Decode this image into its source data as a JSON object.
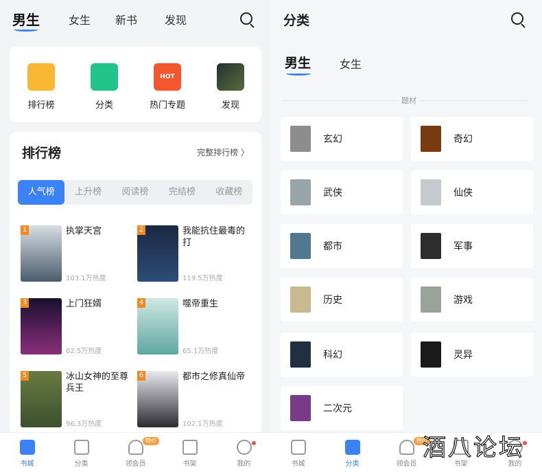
{
  "left": {
    "tabs": [
      "男生",
      "女生",
      "新书",
      "发现"
    ],
    "quick_entries": [
      {
        "label": "排行榜",
        "icon": "ranking-icon",
        "color": "#f7b733"
      },
      {
        "label": "分类",
        "icon": "category-icon",
        "color": "#22c48a"
      },
      {
        "label": "热门专题",
        "icon": "hot-topic-icon",
        "color": "#f4572e"
      },
      {
        "label": "发现",
        "icon": "discover-icon",
        "color": "#3a4a5a"
      }
    ],
    "ranking": {
      "title": "排行榜",
      "more": "完整排行榜 〉",
      "segments": [
        "人气榜",
        "上升榜",
        "阅读榜",
        "完结榜",
        "收藏榜"
      ],
      "books": [
        {
          "rank": "1",
          "name": "执掌天宫",
          "heat": "103.1万热度",
          "color": "#4a5d6e"
        },
        {
          "rank": "2",
          "name": "我能抗住最毒的打",
          "heat": "119.5万热度",
          "color": "#2d4d7a"
        },
        {
          "rank": "3",
          "name": "上门狂婿",
          "heat": "62.5万热度",
          "color": "#8a2f7a"
        },
        {
          "rank": "4",
          "name": "噬帝重生",
          "heat": "65.1万热度",
          "color": "#5fa7a0"
        },
        {
          "rank": "5",
          "name": "冰山女神的至尊兵王",
          "heat": "96.3万热度",
          "color": "#3d5030"
        },
        {
          "rank": "6",
          "name": "都市之修真仙帝",
          "heat": "102.1万热度",
          "color": "#2a2a30"
        }
      ]
    },
    "bottom_nav": [
      {
        "label": "书城",
        "icon": "bookstore-icon"
      },
      {
        "label": "分类",
        "icon": "grid-icon"
      },
      {
        "label": "领会员",
        "icon": "vip-icon",
        "badge": "特价"
      },
      {
        "label": "书架",
        "icon": "bookshelf-icon"
      },
      {
        "label": "我的",
        "icon": "user-icon"
      }
    ]
  },
  "right": {
    "title": "分类",
    "genders": [
      "男生",
      "女生"
    ],
    "section": "题材",
    "categories": [
      {
        "name": "玄幻",
        "color": "#8d8d8d"
      },
      {
        "name": "奇幻",
        "color": "#7a3a10"
      },
      {
        "name": "武侠",
        "color": "#9aa5aa"
      },
      {
        "name": "仙侠",
        "color": "#c7c9d0"
      },
      {
        "name": "都市",
        "color": "#507890"
      },
      {
        "name": "军事",
        "color": "#2d2d2d"
      },
      {
        "name": "历史",
        "color": "#c9b990"
      },
      {
        "name": "游戏",
        "color": "#9aa39a"
      },
      {
        "name": "科幻",
        "color": "#203040"
      },
      {
        "name": "灵异",
        "color": "#1a1a1a"
      },
      {
        "name": "二次元",
        "color": "#7a3a8a"
      }
    ],
    "bottom_nav": [
      {
        "label": "书城",
        "icon": "bookstore-icon"
      },
      {
        "label": "分类",
        "icon": "grid-icon"
      },
      {
        "label": "领会员",
        "icon": "vip-icon",
        "badge": "特价"
      },
      {
        "label": "书架",
        "icon": "bookshelf-icon"
      },
      {
        "label": "我的",
        "icon": "user-icon"
      }
    ]
  },
  "watermark": "酒八论坛",
  "accent": "#3b82f6"
}
